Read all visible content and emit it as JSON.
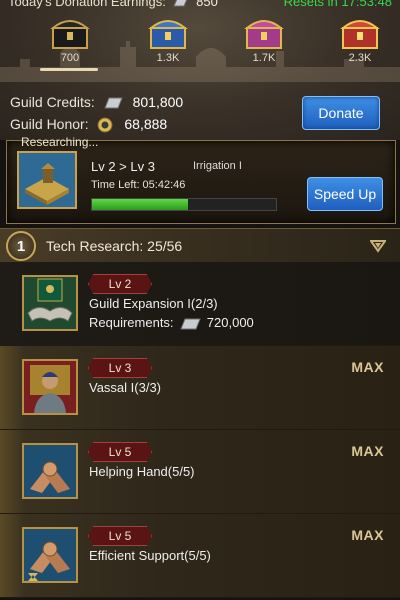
{
  "earnings": {
    "label": "Today's Donation Earnings:",
    "value": "850",
    "reset": "Resets in 17:53:48"
  },
  "chests": [
    {
      "value": "700"
    },
    {
      "value": "1.3K"
    },
    {
      "value": "1.7K"
    },
    {
      "value": "2.3K"
    }
  ],
  "guild": {
    "credits_label": "Guild Credits:",
    "credits_value": "801,800",
    "honor_label": "Guild Honor:",
    "honor_value": "68,888",
    "donate_label": "Donate"
  },
  "research": {
    "header": "Researching...",
    "level": "Lv 2 > Lv 3",
    "name": "Irrigation I",
    "time_left": "Time Left: 05:42:46",
    "progress": 0.52,
    "speed_up_label": "Speed Up"
  },
  "tech": {
    "badge": "1",
    "label": "Tech Research: 25/56"
  },
  "items": [
    {
      "level": "Lv 2",
      "title": "Guild Expansion I(2/3)",
      "req_label": "Requirements:",
      "req_value": "720,000",
      "max": ""
    },
    {
      "level": "Lv 3",
      "title": "Vassal I(3/3)",
      "max": "MAX"
    },
    {
      "level": "Lv 5",
      "title": "Helping Hand(5/5)",
      "max": "MAX"
    },
    {
      "level": "Lv 5",
      "title": "Efficient Support(5/5)",
      "max": "MAX"
    }
  ],
  "colors": {
    "accent_blue": "#2f78d6",
    "reset_green": "#36d94a",
    "gold_border": "#b79146",
    "progress_green": "#4cc236"
  }
}
